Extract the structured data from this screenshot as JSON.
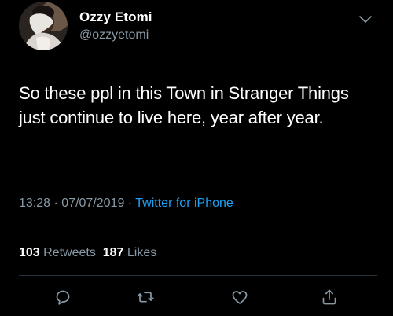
{
  "user": {
    "display_name": "Ozzy Etomi",
    "handle": "@ozzyetomi"
  },
  "tweet": {
    "text": "So these ppl in this Town in Stranger Things just continue to live here, year after year.",
    "time": "13:28",
    "separator1": " · ",
    "date": "07/07/2019",
    "separator2": " · ",
    "source": "Twitter for iPhone"
  },
  "stats": {
    "retweets_count": "103",
    "retweets_label": "Retweets",
    "likes_count": "187",
    "likes_label": "Likes"
  },
  "icons": {
    "reply": "reply-icon",
    "retweet": "retweet-icon",
    "like": "heart-icon",
    "share": "share-icon",
    "menu": "chevron-down-icon"
  },
  "colors": {
    "background": "#000000",
    "text_primary": "#ffffff",
    "text_secondary": "#8899a6",
    "link": "#1da1f2",
    "divider": "#26313b"
  }
}
